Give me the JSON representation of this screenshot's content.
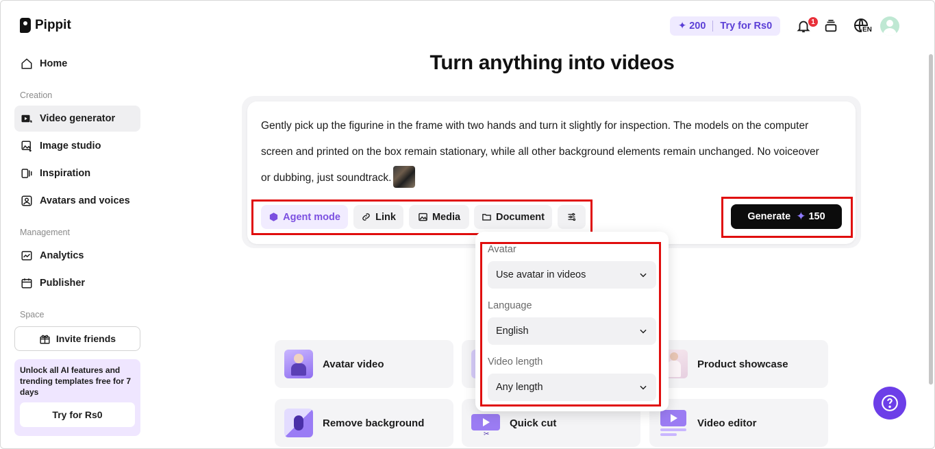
{
  "app": {
    "name": "Pippit"
  },
  "sidebar": {
    "home": "Home",
    "sections": {
      "creation": "Creation",
      "management": "Management",
      "space": "Space"
    },
    "creation_items": [
      "Video generator",
      "Image studio",
      "Inspiration",
      "Avatars and voices"
    ],
    "management_items": [
      "Analytics",
      "Publisher"
    ],
    "invite": "Invite friends",
    "promo": {
      "text": "Unlock all AI features and trending templates free for 7 days",
      "button": "Try for Rs0"
    }
  },
  "header": {
    "credits": "200",
    "try": "Try for Rs0",
    "notifications": "1",
    "language": "EN"
  },
  "main": {
    "title": "Turn anything into videos",
    "prompt": "Gently pick up the figurine in the frame with two hands and turn it slightly for inspection. The models on the computer screen and printed on the box remain stationary, while all other background elements remain unchanged. No voiceover or dubbing, just soundtrack.",
    "tools": {
      "agent": "Agent mode",
      "link": "Link",
      "media": "Media",
      "document": "Document"
    },
    "generate": {
      "label": "Generate",
      "cost": "150"
    }
  },
  "dropdown": {
    "avatar_label": "Avatar",
    "avatar_value": "Use avatar in videos",
    "language_label": "Language",
    "language_value": "English",
    "length_label": "Video length",
    "length_value": "Any length"
  },
  "tiles": {
    "avatar_video": "Avatar video",
    "product_showcase": "Product showcase",
    "remove_background": "Remove background",
    "quick_cut": "Quick cut",
    "video_editor": "Video editor"
  },
  "colors": {
    "accent": "#6c3ee8",
    "highlight_box": "#e00d0d",
    "generate_bg": "#0c0c0c"
  }
}
